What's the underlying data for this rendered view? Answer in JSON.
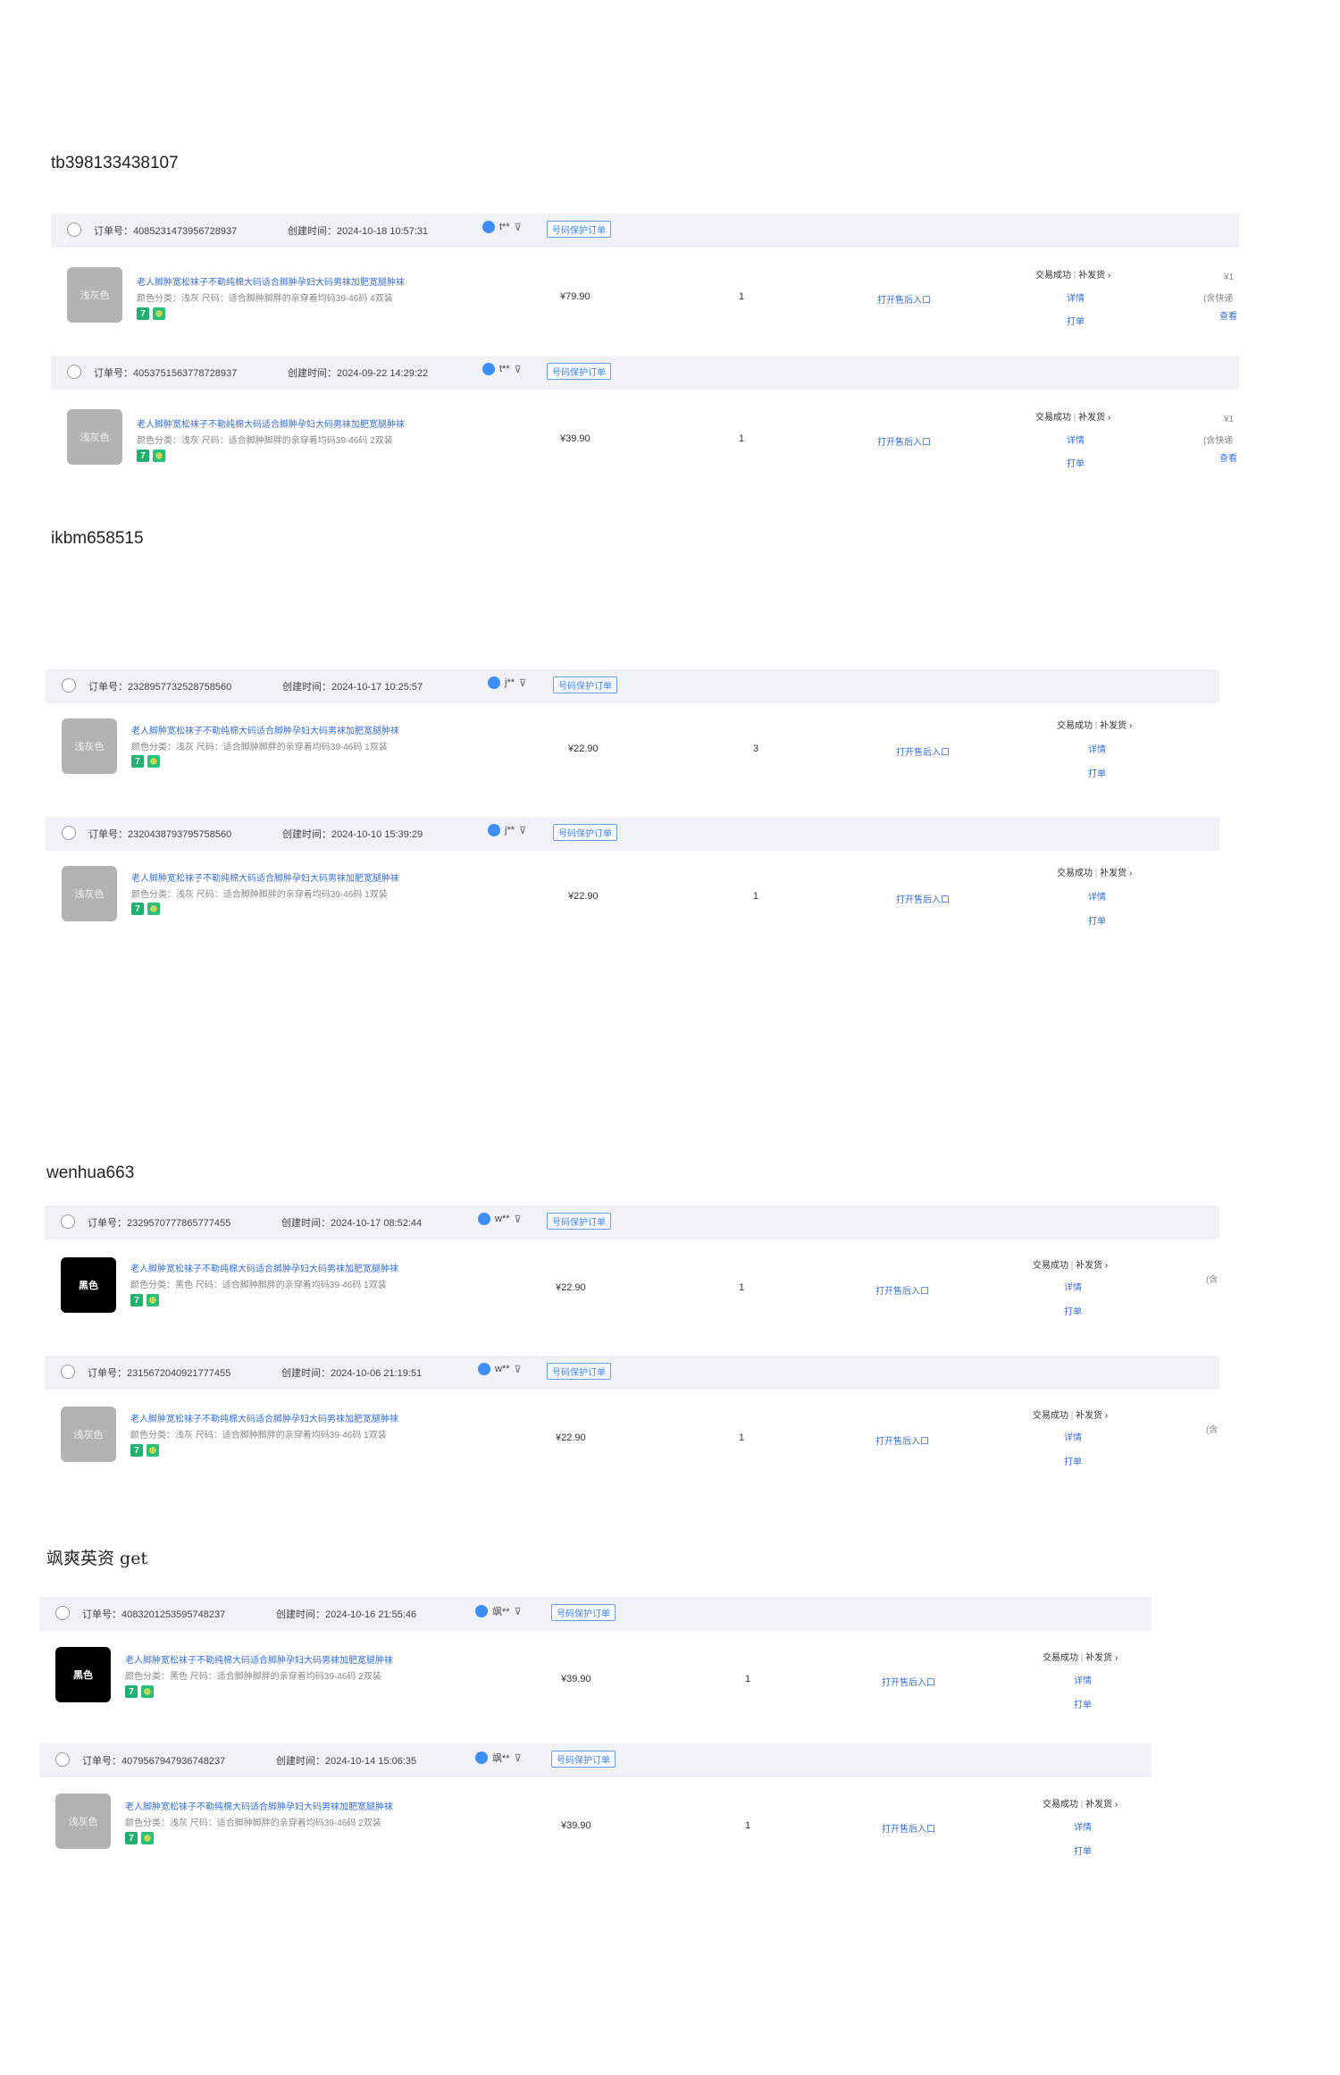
{
  "ui": {
    "status_label": "交易成功",
    "status_sep": "|",
    "status_extra": "补发货 ›",
    "detail_label": "详情",
    "print_label": "打单",
    "aftersale_label": "打开售后入口",
    "tag_label": "号码保护订单",
    "flag_symbol": "⊽",
    "icon_seven": "7",
    "icon_gift": "⊕"
  },
  "sections": [
    {
      "title": "tb398133438107",
      "orders": [
        {
          "order_no": "订单号：4085231473956728937",
          "created": "创建时间：2024-10-18 10:57:31",
          "buyer": "t**",
          "thumb_label": "浅灰色",
          "thumb_color": "#b3b3b3",
          "product_title": "老人脚肿宽松袜子不勒纯棉大码适合脚肿孕妇大码男袜加肥宽腿肿袜",
          "spec": "颜色分类：浅灰  尺码：适合脚肿脚胖的亲穿着均码39-46码 4双装",
          "price": "¥79.90",
          "qty": "1",
          "extra_1": "¥1",
          "extra_2": "(含快递",
          "extra_3": "查看"
        },
        {
          "order_no": "订单号：4053751563778728937",
          "created": "创建时间：2024-09-22 14:29:22",
          "buyer": "t**",
          "thumb_label": "浅灰色",
          "thumb_color": "#b3b3b3",
          "product_title": "老人脚肿宽松袜子不勒纯棉大码适合脚肿孕妇大码男袜加肥宽腿肿袜",
          "spec": "颜色分类：浅灰  尺码：适合脚肿脚胖的亲穿着均码39-46码 2双装",
          "price": "¥39.90",
          "qty": "1",
          "extra_1": "¥1",
          "extra_2": "(含快递",
          "extra_3": "查看"
        }
      ]
    },
    {
      "title": "ikbm658515",
      "orders": [
        {
          "order_no": "订单号：2328957732528758560",
          "created": "创建时间：2024-10-17 10:25:57",
          "buyer": "j**",
          "thumb_label": "浅灰色",
          "thumb_color": "#b3b3b3",
          "product_title": "老人脚肿宽松袜子不勒纯棉大码适合脚肿孕妇大码男袜加肥宽腿肿袜",
          "spec": "颜色分类：浅灰  尺码：适合脚肿脚胖的亲穿着均码39-46码 1双装",
          "price": "¥22.90",
          "qty": "3"
        },
        {
          "order_no": "订单号：2320438793795758560",
          "created": "创建时间：2024-10-10 15:39:29",
          "buyer": "j**",
          "thumb_label": "浅灰色",
          "thumb_color": "#b3b3b3",
          "product_title": "老人脚肿宽松袜子不勒纯棉大码适合脚肿孕妇大码男袜加肥宽腿肿袜",
          "spec": "颜色分类：浅灰  尺码：适合脚肿脚胖的亲穿着均码39-46码 1双装",
          "price": "¥22.90",
          "qty": "1"
        }
      ]
    },
    {
      "title": "wenhua663",
      "orders": [
        {
          "order_no": "订单号：2329570777865777455",
          "created": "创建时间：2024-10-17 08:52:44",
          "buyer": "w**",
          "thumb_label": "黑色",
          "thumb_color": "#000000",
          "product_title": "老人脚肿宽松袜子不勒纯棉大码适合脚肿孕妇大码男袜加肥宽腿肿袜",
          "spec": "颜色分类：黑色  尺码：适合脚肿脚胖的亲穿着均码39-46码 1双装",
          "price": "¥22.90",
          "qty": "1",
          "extra_1": "(含"
        },
        {
          "order_no": "订单号：2315672040921777455",
          "created": "创建时间：2024-10-06 21:19:51",
          "buyer": "w**",
          "thumb_label": "浅灰色",
          "thumb_color": "#b3b3b3",
          "product_title": "老人脚肿宽松袜子不勒纯棉大码适合脚肿孕妇大码男袜加肥宽腿肿袜",
          "spec": "颜色分类：浅灰  尺码：适合脚肿脚胖的亲穿着均码39-46码 1双装",
          "price": "¥22.90",
          "qty": "1",
          "extra_1": "(含"
        }
      ]
    },
    {
      "title": "飒爽英资 get",
      "orders": [
        {
          "order_no": "订单号：4083201253595748237",
          "created": "创建时间：2024-10-16 21:55:46",
          "buyer": "飒**",
          "thumb_label": "黑色",
          "thumb_color": "#000000",
          "product_title": "老人脚肿宽松袜子不勒纯棉大码适合脚肿孕妇大码男袜加肥宽腿肿袜",
          "spec": "颜色分类：黑色  尺码：适合脚肿脚胖的亲穿着均码39-46码 2双装",
          "price": "¥39.90",
          "qty": "1"
        },
        {
          "order_no": "订单号：4079567947936748237",
          "created": "创建时间：2024-10-14 15:06:35",
          "buyer": "飒**",
          "thumb_label": "浅灰色",
          "thumb_color": "#b3b3b3",
          "product_title": "老人脚肿宽松袜子不勒纯棉大码适合脚肿孕妇大码男袜加肥宽腿肿袜",
          "spec": "颜色分类：浅灰  尺码：适合脚肿脚胖的亲穿着均码39-46码 2双装",
          "price": "¥39.90",
          "qty": "1"
        }
      ]
    }
  ]
}
